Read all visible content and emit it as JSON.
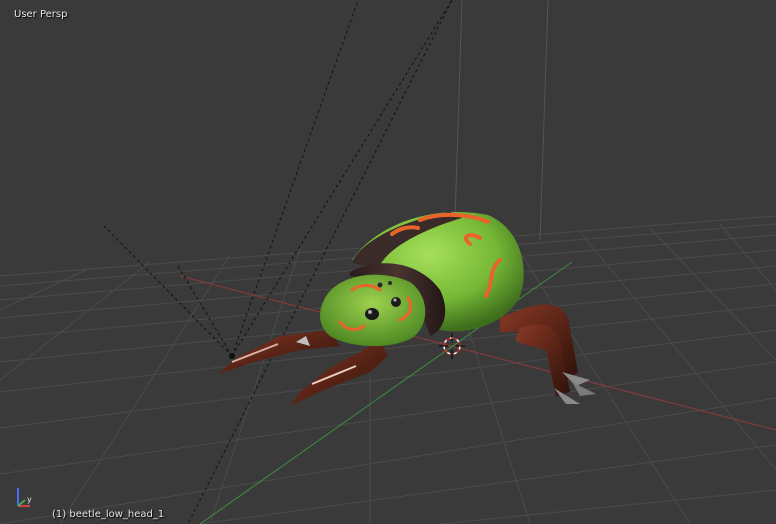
{
  "viewport": {
    "view_label": "User Persp",
    "object_label": "(1) beetle_low_head_1",
    "axis_gizmo": {
      "y_label": "y"
    }
  },
  "colors": {
    "background": "#3a3a3a",
    "grid": "#4a4a4a",
    "x_axis": "#8a3a3a",
    "y_axis": "#3d8a3d",
    "shell": "#7ec23a",
    "shell_stripe": "#e8642a",
    "leg": "#6a2a1a"
  }
}
